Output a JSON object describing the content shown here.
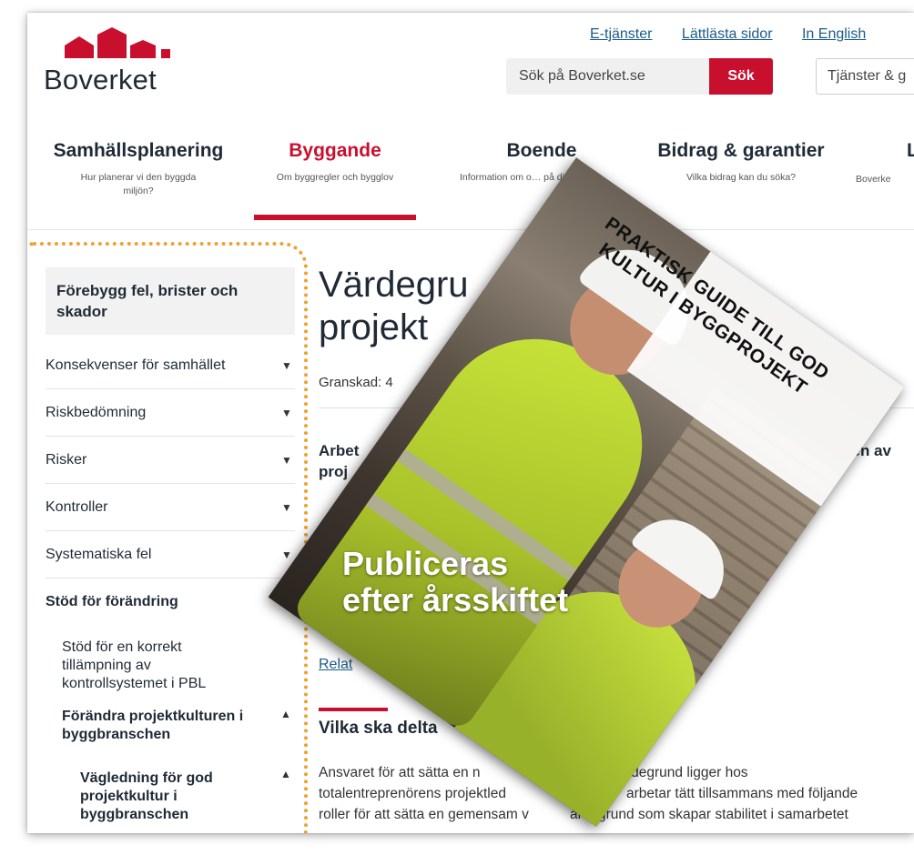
{
  "header": {
    "logo_text": "Boverket",
    "links": [
      "E-tjänster",
      "Lättlästa sidor",
      "In English"
    ],
    "search_placeholder": "Sök på Boverket.se",
    "search_button": "Sök",
    "services_select": "Tjänster & g"
  },
  "nav": [
    {
      "title": "Samhällsplanering",
      "subtitle": "Hur planerar vi den byggda miljön?",
      "active": false
    },
    {
      "title": "Byggande",
      "subtitle": "Om byggregler och bygglov",
      "active": true
    },
    {
      "title": "Boende",
      "subtitle": "Information om o… på ditt b…",
      "active": false
    },
    {
      "title": "Bidrag & garantier",
      "subtitle": "Vilka bidrag kan du söka?",
      "active": false
    },
    {
      "title": "L",
      "subtitle": "Boverke",
      "active": false
    }
  ],
  "sidebar": {
    "heading": "Förebygg fel, brister och skador",
    "items": [
      "Konsekvenser för samhället",
      "Riskbedömning",
      "Risker",
      "Kontroller",
      "Systematiska fel"
    ],
    "current_section": "Stöd för förändring",
    "sub1": "Stöd för en korrekt tillämpning av kontrollsystemet i PBL",
    "sub2": "Förändra projektkulturen i byggbranschen",
    "sub3": "Vägledning för god projektkultur i byggbranschen"
  },
  "content": {
    "title_line1": "Värdegru",
    "title_line2": "projekt",
    "reviewed": "Granskad: 4",
    "lead_left": "Arbet",
    "lead_left2": "proj",
    "lead_right": "ingen av",
    "related": "Relat",
    "h2": "Vilka ska delta",
    "body1a": "Ansvaret för att sätta en n",
    "body1b": "rdegrund ligger hos",
    "body2a": "totalentreprenörens projektled",
    "body2b": "arbetar tätt tillsammans med följande",
    "body3a": "roller för att sätta en gemensam v",
    "body3b": "ärdegrund som skapar stabilitet i samarbetet"
  },
  "poster": {
    "title": "PRAKTISK GUIDE TILL GOD KULTUR I BYGGPROJEKT",
    "subtitle_line1": "Publiceras",
    "subtitle_line2": "efter årsskiftet"
  },
  "colors": {
    "brand_red": "#c8102e",
    "highlight_dots": "#f0a030",
    "link": "#1a5c8a"
  }
}
